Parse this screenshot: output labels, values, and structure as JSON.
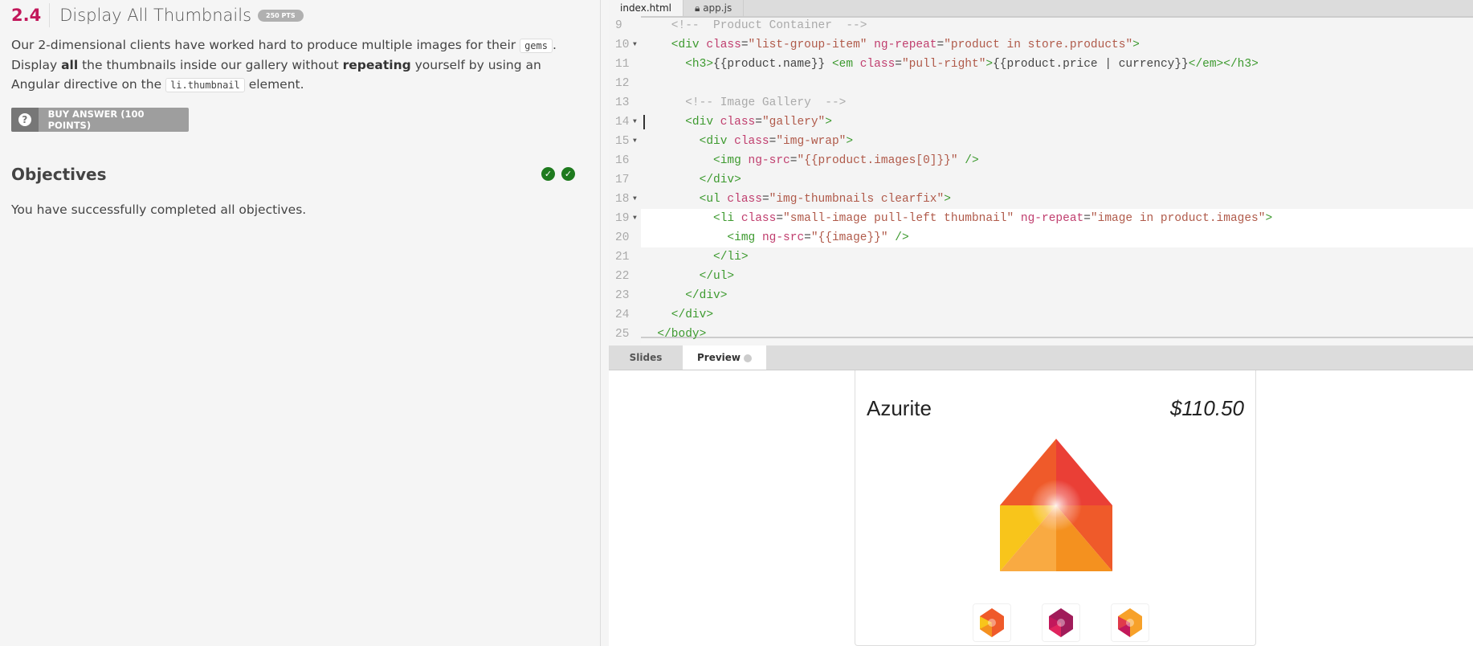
{
  "challenge": {
    "number": "2.4",
    "title": "Display All Thumbnails",
    "points": "250 PTS",
    "desc_1": "Our 2-dimensional clients have worked hard to produce multiple images for their ",
    "code_1": "gems",
    "desc_2": ".",
    "desc_3": "Display ",
    "bold_1": "all",
    "desc_4": " the thumbnails inside our gallery without ",
    "bold_2": "repeating",
    "desc_5": " yourself by using an Angular directive on the ",
    "code_2": "li.thumbnail",
    "desc_6": " element.",
    "buy_label": "BUY ANSWER (100 POINTS)",
    "objectives_title": "Objectives",
    "objectives_status": "You have successfully completed all objectives."
  },
  "editor": {
    "tabs": [
      {
        "label": "index.html"
      },
      {
        "label": "app.js",
        "locked": true
      }
    ],
    "lines": [
      {
        "n": "9",
        "s": [
          [
            "cm",
            "    <!--  Product Container  -->"
          ]
        ]
      },
      {
        "n": "10",
        "fold": true,
        "s": [
          [
            "tag",
            "    <div "
          ],
          [
            "attr",
            "class"
          ],
          [
            "txt",
            "="
          ],
          [
            "str",
            "\"list-group-item\""
          ],
          [
            "attr",
            " ng-repeat"
          ],
          [
            "txt",
            "="
          ],
          [
            "str",
            "\"product in store.products\""
          ],
          [
            "tag",
            ">"
          ]
        ]
      },
      {
        "n": "11",
        "s": [
          [
            "tag",
            "      <h3>"
          ],
          [
            "txt",
            "{{product.name}} "
          ],
          [
            "tag",
            "<em "
          ],
          [
            "attr",
            "class"
          ],
          [
            "txt",
            "="
          ],
          [
            "str",
            "\"pull-right\""
          ],
          [
            "tag",
            ">"
          ],
          [
            "txt",
            "{{product.price | currency}}"
          ],
          [
            "tag",
            "</em></h3>"
          ]
        ]
      },
      {
        "n": "12",
        "s": []
      },
      {
        "n": "13",
        "s": [
          [
            "cm",
            "      <!-- Image Gallery  -->"
          ]
        ]
      },
      {
        "n": "14",
        "fold": true,
        "cursor": true,
        "s": [
          [
            "tag",
            "      <div "
          ],
          [
            "attr",
            "class"
          ],
          [
            "txt",
            "="
          ],
          [
            "str",
            "\"gallery\""
          ],
          [
            "tag",
            ">"
          ]
        ]
      },
      {
        "n": "15",
        "fold": true,
        "s": [
          [
            "tag",
            "        <div "
          ],
          [
            "attr",
            "class"
          ],
          [
            "txt",
            "="
          ],
          [
            "str",
            "\"img-wrap\""
          ],
          [
            "tag",
            ">"
          ]
        ]
      },
      {
        "n": "16",
        "s": [
          [
            "tag",
            "          <img "
          ],
          [
            "attr",
            "ng-src"
          ],
          [
            "txt",
            "="
          ],
          [
            "str",
            "\"{{product.images[0]}}\""
          ],
          [
            "tag",
            " />"
          ]
        ]
      },
      {
        "n": "17",
        "s": [
          [
            "tag",
            "        </div>"
          ]
        ]
      },
      {
        "n": "18",
        "fold": true,
        "s": [
          [
            "tag",
            "        <ul "
          ],
          [
            "attr",
            "class"
          ],
          [
            "txt",
            "="
          ],
          [
            "str",
            "\"img-thumbnails clearfix\""
          ],
          [
            "tag",
            ">"
          ]
        ]
      },
      {
        "n": "19",
        "fold": true,
        "hl": true,
        "s": [
          [
            "tag",
            "          <li "
          ],
          [
            "attr",
            "class"
          ],
          [
            "txt",
            "="
          ],
          [
            "str",
            "\"small-image pull-left thumbnail\""
          ],
          [
            "attr",
            " ng-repeat"
          ],
          [
            "txt",
            "="
          ],
          [
            "str",
            "\"image in product.images\""
          ],
          [
            "tag",
            ">"
          ]
        ]
      },
      {
        "n": "20",
        "hl": true,
        "s": [
          [
            "tag",
            "            <img "
          ],
          [
            "attr",
            "ng-src"
          ],
          [
            "txt",
            "="
          ],
          [
            "str",
            "\"{{image}}\""
          ],
          [
            "tag",
            " />"
          ]
        ]
      },
      {
        "n": "21",
        "s": [
          [
            "tag",
            "          </li>"
          ]
        ]
      },
      {
        "n": "22",
        "s": [
          [
            "tag",
            "        </ul>"
          ]
        ]
      },
      {
        "n": "23",
        "s": [
          [
            "tag",
            "      </div>"
          ]
        ]
      },
      {
        "n": "24",
        "s": [
          [
            "tag",
            "    </div>"
          ]
        ]
      },
      {
        "n": "25",
        "s": [
          [
            "tag",
            "  </body>"
          ]
        ]
      }
    ]
  },
  "preview_tabs": [
    {
      "label": "Slides"
    },
    {
      "label": "Preview",
      "active": true
    }
  ],
  "product": {
    "name": "Azurite",
    "price": "$110.50",
    "thumbnails": [
      "orange-gem",
      "magenta-gem",
      "red-orange-gem"
    ]
  },
  "colors": {
    "accent": "#c2185b",
    "check": "#1e7a1e"
  }
}
